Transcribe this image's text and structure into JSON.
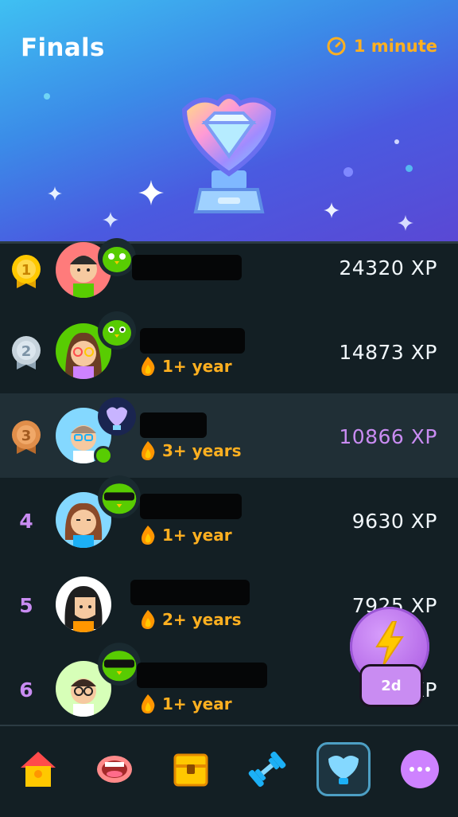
{
  "header": {
    "title": "Finals",
    "timer_icon": "clock-icon",
    "timer_text": "1 minute",
    "trophy_icon": "diamond-trophy-icon"
  },
  "leaderboard": [
    {
      "rank": "1",
      "medal": "gold",
      "xp": "24320 XP",
      "streak": ""
    },
    {
      "rank": "2",
      "medal": "silver",
      "xp": "14873 XP",
      "streak": "1+ year"
    },
    {
      "rank": "3",
      "medal": "bronze",
      "xp": "10866 XP",
      "streak": "3+ years",
      "is_current_user": true
    },
    {
      "rank": "4",
      "xp": "9630 XP",
      "streak": "1+ year"
    },
    {
      "rank": "5",
      "xp": "7925 XP",
      "streak": "2+ years"
    },
    {
      "rank": "6",
      "xp": "7 XP",
      "streak": "1+ year"
    }
  ],
  "boost": {
    "icon": "lightning-icon",
    "label": "2d"
  },
  "nav": {
    "items": [
      {
        "name": "home",
        "icon": "house-icon"
      },
      {
        "name": "speak",
        "icon": "mouth-icon"
      },
      {
        "name": "chest",
        "icon": "treasure-chest-icon"
      },
      {
        "name": "practice",
        "icon": "dumbbell-icon"
      },
      {
        "name": "leagues",
        "icon": "shield-trophy-icon",
        "active": true
      },
      {
        "name": "more",
        "icon": "more-dots-icon"
      }
    ]
  },
  "colors": {
    "background": "#131f24",
    "highlight_row": "#202f36",
    "accent_purple": "#c98cf2",
    "streak_orange": "#ffb020",
    "text": "#f1f7fb"
  }
}
